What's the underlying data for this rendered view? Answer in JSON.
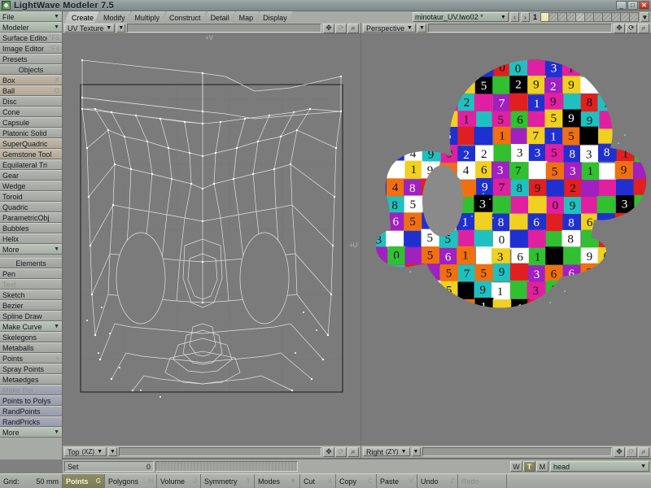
{
  "window": {
    "title": "LightWave Modeler 7.5",
    "app_icon": "lightwave-logo-icon",
    "controls": [
      {
        "name": "minimize",
        "glyph": "_"
      },
      {
        "name": "maximize",
        "glyph": "□"
      },
      {
        "name": "close",
        "glyph": "✕"
      }
    ]
  },
  "sidebar": {
    "top": [
      {
        "label": "File",
        "type": "dropdown",
        "caret": "▼"
      },
      {
        "label": "Modeler",
        "type": "dropdown",
        "caret": "▼"
      },
      {
        "label": "Surface Editor",
        "hotkey": "^F3"
      },
      {
        "label": "Image Editor",
        "hotkey": "^F4"
      },
      {
        "label": "Presets"
      }
    ],
    "objects_header": "Objects",
    "objects": [
      {
        "label": "Box",
        "hotkey": "X",
        "style": "tan"
      },
      {
        "label": "Ball",
        "hotkey": "O",
        "style": "tan"
      },
      {
        "label": "Disc"
      },
      {
        "label": "Cone"
      },
      {
        "label": "Capsule"
      },
      {
        "label": "Platonic Solid"
      },
      {
        "label": "SuperQuadric",
        "style": "tan"
      },
      {
        "label": "Gemstone Tool",
        "style": "tan"
      },
      {
        "label": "Equilateral Tri"
      },
      {
        "label": "Gear"
      },
      {
        "label": "Wedge"
      },
      {
        "label": "Toroid"
      },
      {
        "label": "Quadric"
      },
      {
        "label": "ParametricObj"
      },
      {
        "label": "Bubbles"
      },
      {
        "label": "Helix"
      },
      {
        "label": "More",
        "type": "dropdown",
        "caret": "▼"
      }
    ],
    "elements_header": "Elements",
    "elements": [
      {
        "label": "Pen"
      },
      {
        "label": "Text",
        "disabled": true
      },
      {
        "label": "Sketch"
      },
      {
        "label": "Bezier"
      },
      {
        "label": "Spline Draw"
      },
      {
        "label": "Make Curve",
        "type": "dropdown",
        "caret": "▼"
      },
      {
        "label": "Skelegons"
      },
      {
        "label": "Metaballs"
      },
      {
        "label": "Points",
        "hotkey": "+"
      },
      {
        "label": "Spray Points"
      },
      {
        "label": "Metaedges"
      },
      {
        "label": "Make Pol",
        "disabled": true,
        "style": "blu"
      },
      {
        "label": "Points to Polys",
        "style": "blu"
      },
      {
        "label": "RandPoints",
        "style": "blu"
      },
      {
        "label": "RandPricks",
        "style": "blu"
      },
      {
        "label": "More",
        "type": "dropdown",
        "caret": "▼"
      }
    ]
  },
  "tabs": [
    {
      "label": "Create",
      "active": true
    },
    {
      "label": "Modify",
      "active": false
    },
    {
      "label": "Multiply",
      "active": false
    },
    {
      "label": "Construct",
      "active": false
    },
    {
      "label": "Detail",
      "active": false
    },
    {
      "label": "Map",
      "active": false
    },
    {
      "label": "Display",
      "active": false
    }
  ],
  "layer_bar": {
    "object_name": "minotaur_UV.lwo02 *",
    "prev_glyph": "‹",
    "next_glyph": "›",
    "layer_number": "1",
    "dropdown_caret": "▼",
    "layer_boxes": [
      {
        "state": "selected"
      },
      {
        "state": "hatch"
      },
      {
        "state": "hatch"
      },
      {
        "state": "hatch"
      },
      {
        "state": "light"
      },
      {
        "state": "hatch"
      },
      {
        "state": "hatch"
      },
      {
        "state": "hatch"
      },
      {
        "state": "hatch"
      },
      {
        "state": "hatch"
      },
      {
        "state": "hatch"
      }
    ]
  },
  "viewports": [
    {
      "name": "uv-texture-viewport",
      "label": "UV Texture",
      "axis": "",
      "caret": "▼",
      "menu_caret": "▼",
      "tools": [
        {
          "name": "pan-tool",
          "glyph": "✥"
        },
        {
          "name": "rotate-tool",
          "glyph": "⟳",
          "dim": true
        },
        {
          "name": "zoom-tool",
          "glyph": "⌕"
        }
      ],
      "axis_labels": [
        {
          "text": "+V",
          "pos": "top"
        },
        {
          "text": "+U",
          "pos": "right"
        }
      ]
    },
    {
      "name": "perspective-viewport",
      "label": "Perspective",
      "axis": "",
      "caret": "▼",
      "menu_caret": "▼",
      "tools": [
        {
          "name": "pan-tool",
          "glyph": "✥"
        },
        {
          "name": "rotate-tool",
          "glyph": "⟳"
        },
        {
          "name": "zoom-tool",
          "glyph": "⌕"
        }
      ],
      "axis_labels": []
    },
    {
      "name": "top-viewport",
      "label": "Top",
      "axis": "(XZ)",
      "caret": "▼",
      "menu_caret": "▼",
      "tools": [
        {
          "name": "pan-tool",
          "glyph": "✥"
        },
        {
          "name": "rotate-tool",
          "glyph": "⟳",
          "dim": true
        },
        {
          "name": "zoom-tool",
          "glyph": "⌕"
        }
      ],
      "axis_labels": []
    },
    {
      "name": "right-viewport",
      "label": "Right",
      "axis": "(ZY)",
      "caret": "▼",
      "menu_caret": "▼",
      "tools": [
        {
          "name": "pan-tool",
          "glyph": "✥"
        },
        {
          "name": "rotate-tool",
          "glyph": "⟳",
          "dim": true
        },
        {
          "name": "zoom-tool",
          "glyph": "⌕"
        }
      ],
      "axis_labels": []
    }
  ],
  "set_row": {
    "set_label": "Set",
    "set_value": "0",
    "mode_buttons": [
      {
        "label": "W",
        "active": false
      },
      {
        "label": "T",
        "active": true
      },
      {
        "label": "M",
        "active": false
      }
    ],
    "surface_name": "head",
    "surface_caret": "▼"
  },
  "statusbar": {
    "grid_label": "Grid:",
    "grid_value": "50 mm",
    "items": [
      {
        "label": "Points",
        "hotkey": "G",
        "selected": true
      },
      {
        "label": "Polygons",
        "hotkey": "H"
      },
      {
        "label": "Volume",
        "hotkey": "J"
      },
      {
        "label": "Symmetry",
        "hotkey": "Y"
      },
      {
        "label": "Modes",
        "hotkey": "▼"
      },
      {
        "label": "Cut",
        "hotkey": "X"
      },
      {
        "label": "Copy",
        "hotkey": "C"
      },
      {
        "label": "Paste",
        "hotkey": "V"
      },
      {
        "label": "Undo",
        "hotkey": "Z"
      },
      {
        "label": "Redo",
        "hotkey": "",
        "disabled": true
      }
    ]
  },
  "colors": {
    "chrome": "#a8aba5",
    "viewport_bg": "#7b7b7b",
    "wireframe": "#e8e8e8",
    "selected_accent": "#8c8d68",
    "title_bar": "#8d9898"
  },
  "model": {
    "description": "minotaur head with UV checker number texture",
    "palette": [
      "#e02020",
      "#f07010",
      "#f0d020",
      "#30c030",
      "#20c0c0",
      "#2030d0",
      "#a020c0",
      "#000000",
      "#ffffff",
      "#e020a0"
    ],
    "numbers": [
      "1",
      "2",
      "3",
      "4",
      "5",
      "6",
      "7",
      "8",
      "9",
      "0"
    ]
  }
}
